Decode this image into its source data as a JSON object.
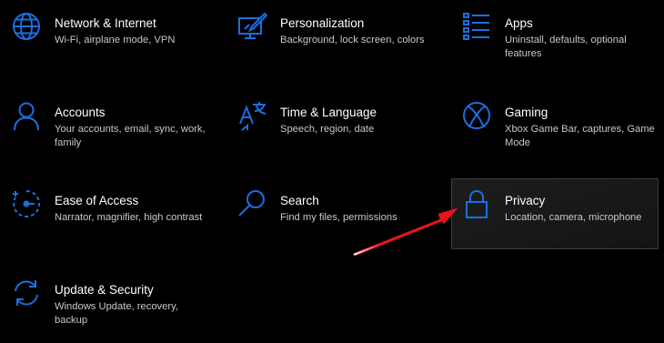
{
  "colors": {
    "accent": "#1a6fe0",
    "background": "#000000",
    "title": "#ffffff",
    "description": "#c8c8c8",
    "arrow": "#e8141b"
  },
  "tiles": [
    {
      "key": "network",
      "icon": "globe-icon",
      "title": "Network & Internet",
      "desc": "Wi-Fi, airplane mode, VPN"
    },
    {
      "key": "personalization",
      "icon": "personalization-icon",
      "title": "Personalization",
      "desc": "Background, lock screen, colors"
    },
    {
      "key": "apps",
      "icon": "apps-list-icon",
      "title": "Apps",
      "desc": "Uninstall, defaults, optional features"
    },
    {
      "key": "accounts",
      "icon": "person-icon",
      "title": "Accounts",
      "desc": "Your accounts, email, sync, work, family"
    },
    {
      "key": "time-language",
      "icon": "language-icon",
      "title": "Time & Language",
      "desc": "Speech, region, date"
    },
    {
      "key": "gaming",
      "icon": "xbox-icon",
      "title": "Gaming",
      "desc": "Xbox Game Bar, captures, Game Mode"
    },
    {
      "key": "ease-of-access",
      "icon": "ease-of-access-icon",
      "title": "Ease of Access",
      "desc": "Narrator, magnifier, high contrast"
    },
    {
      "key": "search",
      "icon": "search-icon",
      "title": "Search",
      "desc": "Find my files, permissions"
    },
    {
      "key": "privacy",
      "icon": "lock-icon",
      "title": "Privacy",
      "desc": "Location, camera, microphone"
    },
    {
      "key": "update-security",
      "icon": "sync-icon",
      "title": "Update & Security",
      "desc": "Windows Update, recovery, backup"
    }
  ],
  "annotation": {
    "icon": "red-arrow-icon",
    "points_to": "Privacy"
  }
}
